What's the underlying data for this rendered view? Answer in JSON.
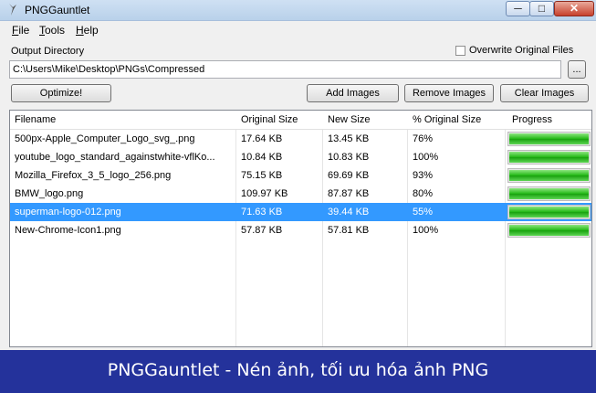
{
  "window": {
    "title": "PNGGauntlet"
  },
  "menu": {
    "file": "F",
    "file_rest": "ile",
    "tools": "T",
    "tools_rest": "ools",
    "help": "H",
    "help_rest": "elp"
  },
  "output": {
    "label": "Output Directory",
    "overwrite_label": "Overwrite Original Files",
    "overwrite_checked": false,
    "path": "C:\\Users\\Mike\\Desktop\\PNGs\\Compressed",
    "browse_label": "..."
  },
  "buttons": {
    "optimize": "Optimize!",
    "add": "Add Images",
    "remove": "Remove Images",
    "clear": "Clear Images"
  },
  "table": {
    "columns": [
      "Filename",
      "Original Size",
      "New Size",
      "% Original Size",
      "Progress"
    ],
    "rows": [
      {
        "filename": "500px-Apple_Computer_Logo_svg_.png",
        "original": "17.64 KB",
        "new": "13.45 KB",
        "pct": "76%",
        "progress": 1.0
      },
      {
        "filename": "youtube_logo_standard_againstwhite-vflKo...",
        "original": "10.84 KB",
        "new": "10.83 KB",
        "pct": "100%",
        "progress": 1.0
      },
      {
        "filename": "Mozilla_Firefox_3_5_logo_256.png",
        "original": "75.15 KB",
        "new": "69.69 KB",
        "pct": "93%",
        "progress": 1.0
      },
      {
        "filename": "BMW_logo.png",
        "original": "109.97 KB",
        "new": "87.87 KB",
        "pct": "80%",
        "progress": 1.0
      },
      {
        "filename": "superman-logo-012.png",
        "original": "71.63 KB",
        "new": "39.44 KB",
        "pct": "55%",
        "progress": 1.0,
        "selected": true
      },
      {
        "filename": "New-Chrome-Icon1.png",
        "original": "57.87 KB",
        "new": "57.81 KB",
        "pct": "100%",
        "progress": 1.0
      }
    ]
  },
  "banner": {
    "text": "PNGGauntlet - Nén ảnh, tối ưu hóa ảnh PNG",
    "color": "#24329b"
  },
  "colors": {
    "selection": "#3399ff",
    "progress_green": "#21b814"
  }
}
